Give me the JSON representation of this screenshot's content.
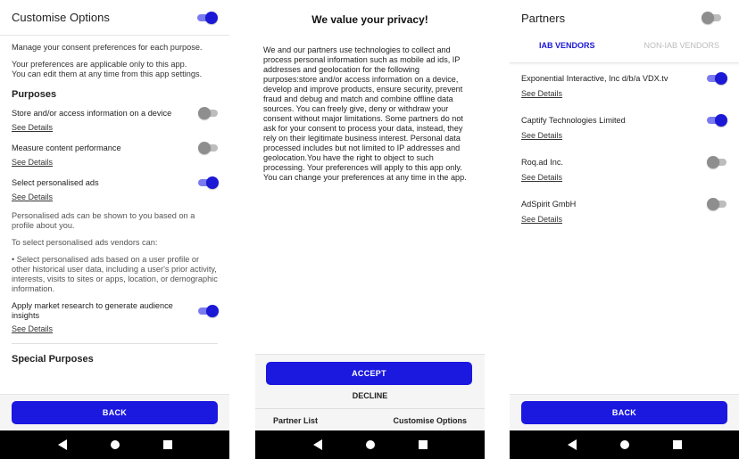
{
  "customise": {
    "title": "Customise Options",
    "intro1": "Manage your consent preferences for each purpose.",
    "intro2_line1": "Your preferences are applicable only to this app.",
    "intro2_line2": "You can edit them at any time from this app settings.",
    "purposes_title": "Purposes",
    "purposes": [
      {
        "label": "Store and/or access information on a device",
        "see": "See Details",
        "on": false
      },
      {
        "label": "Measure content performance",
        "see": "See Details",
        "on": false
      },
      {
        "label": "Select personalised ads",
        "see": "See Details",
        "on": true
      }
    ],
    "ads_desc1": "Personalised ads can be shown to you based on a profile about you.",
    "ads_desc2": "To select personalised ads vendors can:",
    "ads_desc3": "• Select personalised ads based on a user profile or other historical user data, including a user's prior activity, interests, visits to sites or apps, location, or demographic information.",
    "market": {
      "label": "Apply market research to generate audience insights",
      "see": "See Details",
      "on": true
    },
    "special_title": "Special Purposes",
    "back_label": "BACK"
  },
  "privacy": {
    "title": "We value your privacy!",
    "body": "We and our partners use technologies to collect and process personal information such as mobile ad ids, IP addresses and geolocation for the following purposes:store and/or access information on a device, develop and improve products, ensure security, prevent fraud and debug and match and combine offline data sources. You can freely give, deny or withdraw your consent without major limitations. Some partners do not ask for your consent to process your data, instead, they rely on their legitimate business interest. Personal data processed includes but not limited to IP addresses and geolocation.You have the right to object to such processing. Your preferences will apply to this app only. You can change your preferences at any time in the app.",
    "accept_label": "ACCEPT",
    "decline_label": "DECLINE",
    "partner_list_label": "Partner List",
    "customise_label": "Customise Options"
  },
  "partners": {
    "title": "Partners",
    "tab_iab": "IAB VENDORS",
    "tab_non_iab": "NON-IAB VENDORS",
    "vendors": [
      {
        "name": "Exponential Interactive, Inc d/b/a VDX.tv",
        "see": "See Details",
        "on": true
      },
      {
        "name": "Captify Technologies Limited",
        "see": "See Details",
        "on": true
      },
      {
        "name": "Roq.ad Inc.",
        "see": "See Details",
        "on": false
      },
      {
        "name": "AdSpirit GmbH",
        "see": "See Details",
        "on": false
      }
    ],
    "back_label": "BACK"
  },
  "colors": {
    "accent": "#1b18e0",
    "toggle_on_knob": "#1b18d6",
    "toggle_on_track": "#7a7bf0",
    "toggle_off_knob": "#8e8e8e",
    "toggle_off_track": "#bdbdbd",
    "navbar": "#000000"
  },
  "icons": {
    "nav_back": "triangle-back-icon",
    "nav_home": "circle-home-icon",
    "nav_recent": "square-recents-icon"
  }
}
